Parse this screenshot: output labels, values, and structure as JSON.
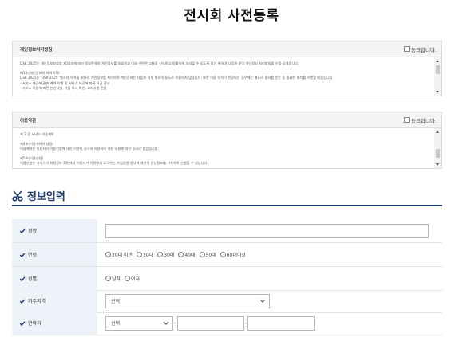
{
  "page": {
    "title": "전시회 사전등록"
  },
  "privacy": {
    "heading": "개인정보처리방침",
    "agree_label": "동의합니다.",
    "lines": [
      "DSK 2025는 개인정보보호법 제30조에 따라 정보주체의 개인정보를 보호하고 이와 관련한 고충을 신속하고 원활하게 처리할 수 있도록 하기 위하여 다음과 같이 개인정보 처리방침을 수립·공개합니다.",
      "",
      "제1조(개인정보의 처리목적)",
      "DSK 2025는 'DSK 2025' 행사의 목적을 위하여 개인정보를 처리하며 개인정보는 다음의 목적 이외의 용도로 이용되지 않습니다. 또한 이용 목적이 변경되는 경우에는 별도의 동의를 받는 등 필요한 조치를 이행할 예정입니다.",
      "- 서비스 제공에 관한 계약 이행 및 서비스 제공에 따른 요금 정산",
      "- 서비스 이용에 따른 본인식별, 가입 의사 확인, 고지사항 전달"
    ]
  },
  "terms": {
    "heading": "이용약관",
    "agree_label": "동의합니다.",
    "lines": [
      "제 2 장 서비스 이용계약",
      "",
      "제4조(이용계약의 성립)",
      "이용계약은 이용자의 이용신청에 대한 기관의 승낙과 이용자의 약관 내용에 대한 동의로 성립됩니다.",
      "",
      "제5조(이용신청)",
      "이용신청은 서비스의 회원정보 화면에서 이용자가 기관에서 요구하는 가입신청 양식에 개인의 신상정보를 기록하여 신청할 수 있습니다."
    ]
  },
  "section": {
    "title": "정보입력"
  },
  "form": {
    "name": {
      "label": "성명",
      "value": ""
    },
    "age": {
      "label": "연령",
      "options": [
        "20대 미만",
        "20대",
        "30대",
        "40대",
        "50대",
        "60대이상"
      ]
    },
    "gender": {
      "label": "성별",
      "options": [
        "남자",
        "여자"
      ]
    },
    "region": {
      "label": "거주지역",
      "selected": "선택"
    },
    "phone": {
      "label": "연락처",
      "prefix_selected": "선택",
      "middle": "",
      "last": ""
    }
  },
  "colors": {
    "accent": "#1d3b6e",
    "label_bg": "#eef3f9",
    "check": "#1d3b6e"
  }
}
